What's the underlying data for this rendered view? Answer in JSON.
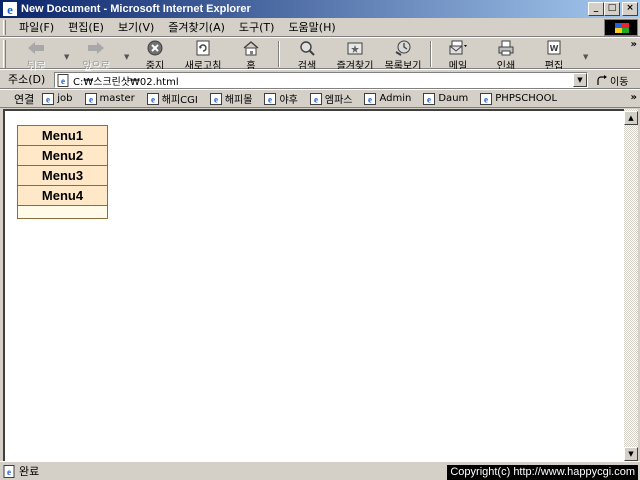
{
  "window": {
    "title": "New Document - Microsoft Internet Explorer"
  },
  "title_buttons": {
    "minimize": "_",
    "maximize": "□",
    "close": "×"
  },
  "menubar": {
    "items": [
      "파일(F)",
      "편집(E)",
      "보기(V)",
      "즐겨찾기(A)",
      "도구(T)",
      "도움말(H)"
    ]
  },
  "toolbar": {
    "back": "뒤로",
    "forward": "앞으로",
    "stop": "중지",
    "refresh": "새로고침",
    "home": "홈",
    "search": "검색",
    "favorites": "즐겨찾기",
    "history": "목록보기",
    "mail": "메일",
    "print": "인쇄",
    "edit": "편집",
    "more": "»"
  },
  "address": {
    "label": "주소(D)",
    "value": "C:₩스크린샷₩02.html",
    "go_label": "이동"
  },
  "links": {
    "label": "연결",
    "items": [
      "job",
      "master",
      "해피CGI",
      "해피몰",
      "야후",
      "엠파스",
      "Admin",
      "Daum",
      "PHPSCHOOL"
    ],
    "more": "»"
  },
  "page": {
    "menu_items": [
      "Menu1",
      "Menu2",
      "Menu3",
      "Menu4"
    ]
  },
  "status": {
    "text": "완료",
    "copyright": "Copyright(c) http://www.happycgi.com"
  },
  "colors": {
    "menu_cell_bg": "#ffe8c8",
    "menu_border": "#8b6d3a",
    "titlebar": "#0a246a"
  }
}
